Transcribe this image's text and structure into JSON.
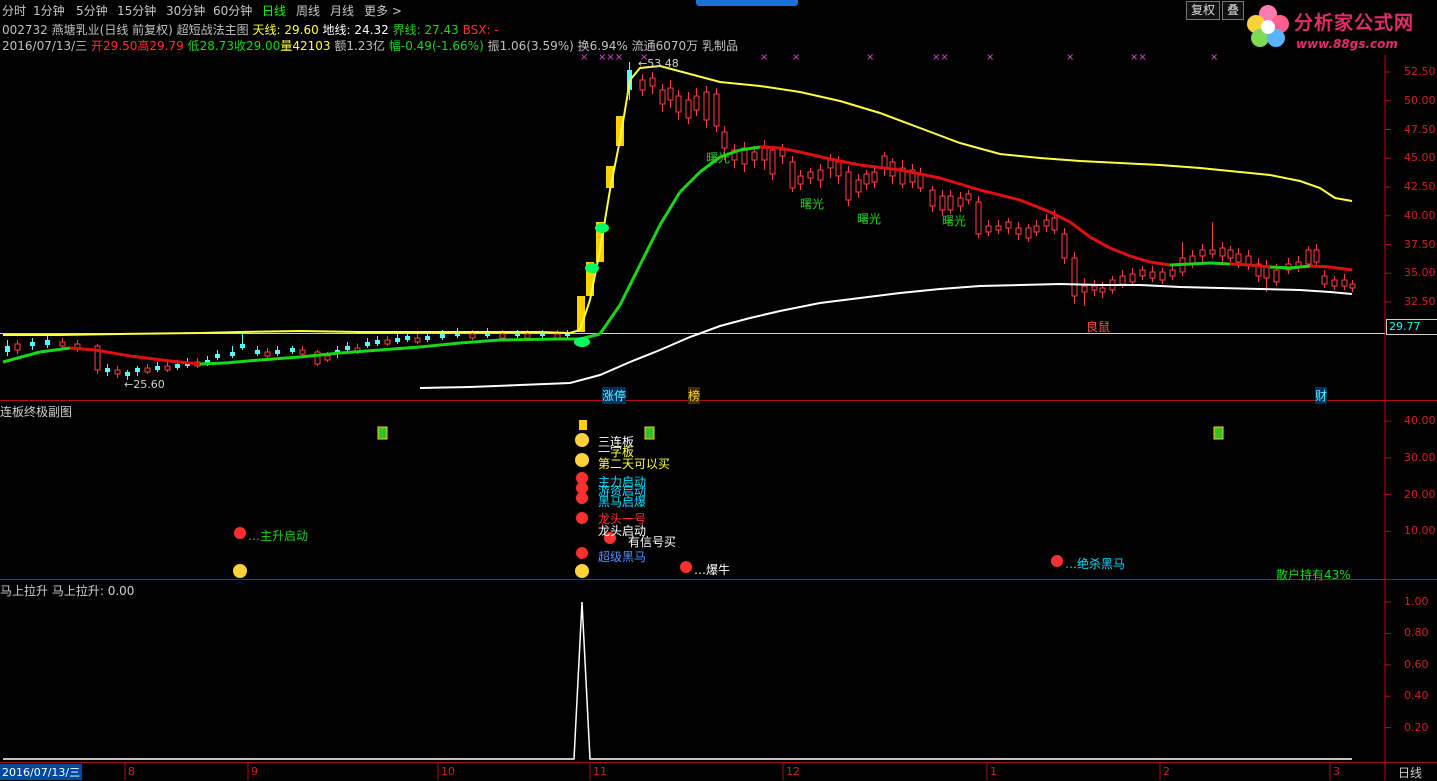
{
  "toolbar": {
    "timeframes": [
      "分时",
      "1分钟",
      "5分钟",
      "15分钟",
      "30分钟",
      "60分钟",
      "日线",
      "周线",
      "月线",
      "更多 >"
    ],
    "active": "日线",
    "fuquan_button": "复权",
    "stack_button": "叠"
  },
  "logo": {
    "text": "分析家公式网",
    "url": "www.88gs.com"
  },
  "header": {
    "code": "002732",
    "name": "燕塘乳业(日线 前复权)",
    "indicator": "超短战法主图",
    "tian_label": "天线: 29.60",
    "di_label": "地线: 24.32",
    "jie_label": "界线: 27.43",
    "bsx_label": "BSX: -",
    "date": "2016/07/13/三",
    "open": "开29.50",
    "high": "高29.79",
    "low": "低28.73",
    "close": "收29.00",
    "volume": "量42103",
    "amount": "额1.23亿",
    "change": "幅-0.49(-1.66%)",
    "amplitude": "振1.06(3.59%)",
    "turnover": "换6.94%",
    "float": "流通6070万",
    "sector": "乳制品"
  },
  "main_chart": {
    "price_axis": [
      "52.50",
      "50.00",
      "47.50",
      "45.00",
      "42.50",
      "40.00",
      "37.50",
      "35.00",
      "32.50"
    ],
    "price_axis_values": [
      52.5,
      50,
      47.5,
      45,
      42.5,
      40,
      37.5,
      35,
      32.5
    ],
    "current_price_tag": "29.77",
    "max_label": "53.48",
    "min_label": "25.60",
    "annotations": [
      "曙光",
      "曙光",
      "曙光",
      "曙光",
      "良鼠",
      "涨停",
      "榜",
      "财"
    ],
    "colors": {
      "up": "#ff4040",
      "down": "#54fcfc",
      "green_line": "#19d619",
      "red_line": "#e01010",
      "yellow_line": "#ffff40",
      "white_line": "#ffffff"
    }
  },
  "sub1": {
    "title": "连板终极副图",
    "axis": [
      "40.00",
      "30.00",
      "20.00",
      "10.00"
    ],
    "axis_values": [
      40,
      30,
      20,
      10
    ],
    "signals": [
      "三连板",
      "一字板",
      "第二天可以买",
      "主力启动",
      "游资启动",
      "黑马启爆",
      "龙头一号",
      "龙头启动",
      "有信号买",
      "超级黑马",
      "主升启动",
      "爆牛",
      "绝杀黑马"
    ],
    "retail_holding": "散户持有43%"
  },
  "sub2": {
    "title": "马上拉升",
    "value_label": "马上拉升: 0.00",
    "axis": [
      "1.00",
      "0.80",
      "0.60",
      "0.40",
      "0.20"
    ],
    "axis_values": [
      1.0,
      0.8,
      0.6,
      0.4,
      0.2
    ]
  },
  "date_axis": {
    "cursor_date": "2016/07/13/三",
    "months": [
      "8",
      "9",
      "10",
      "11",
      "12",
      "1",
      "2",
      "3"
    ],
    "period": "日线"
  },
  "chart_data": [
    {
      "type": "line",
      "title": "马上拉升",
      "series": [
        {
          "name": "马上拉升",
          "values": [
            0,
            0,
            0,
            0,
            0,
            0,
            0,
            0,
            0,
            0,
            0,
            0,
            0,
            0,
            0,
            0,
            1,
            0,
            0,
            0,
            0,
            0,
            0,
            0,
            0,
            0,
            0,
            0,
            0,
            0,
            0,
            0,
            0,
            0,
            0,
            0,
            0,
            0,
            0,
            0
          ]
        }
      ],
      "ylim": [
        0,
        1.05
      ]
    }
  ]
}
